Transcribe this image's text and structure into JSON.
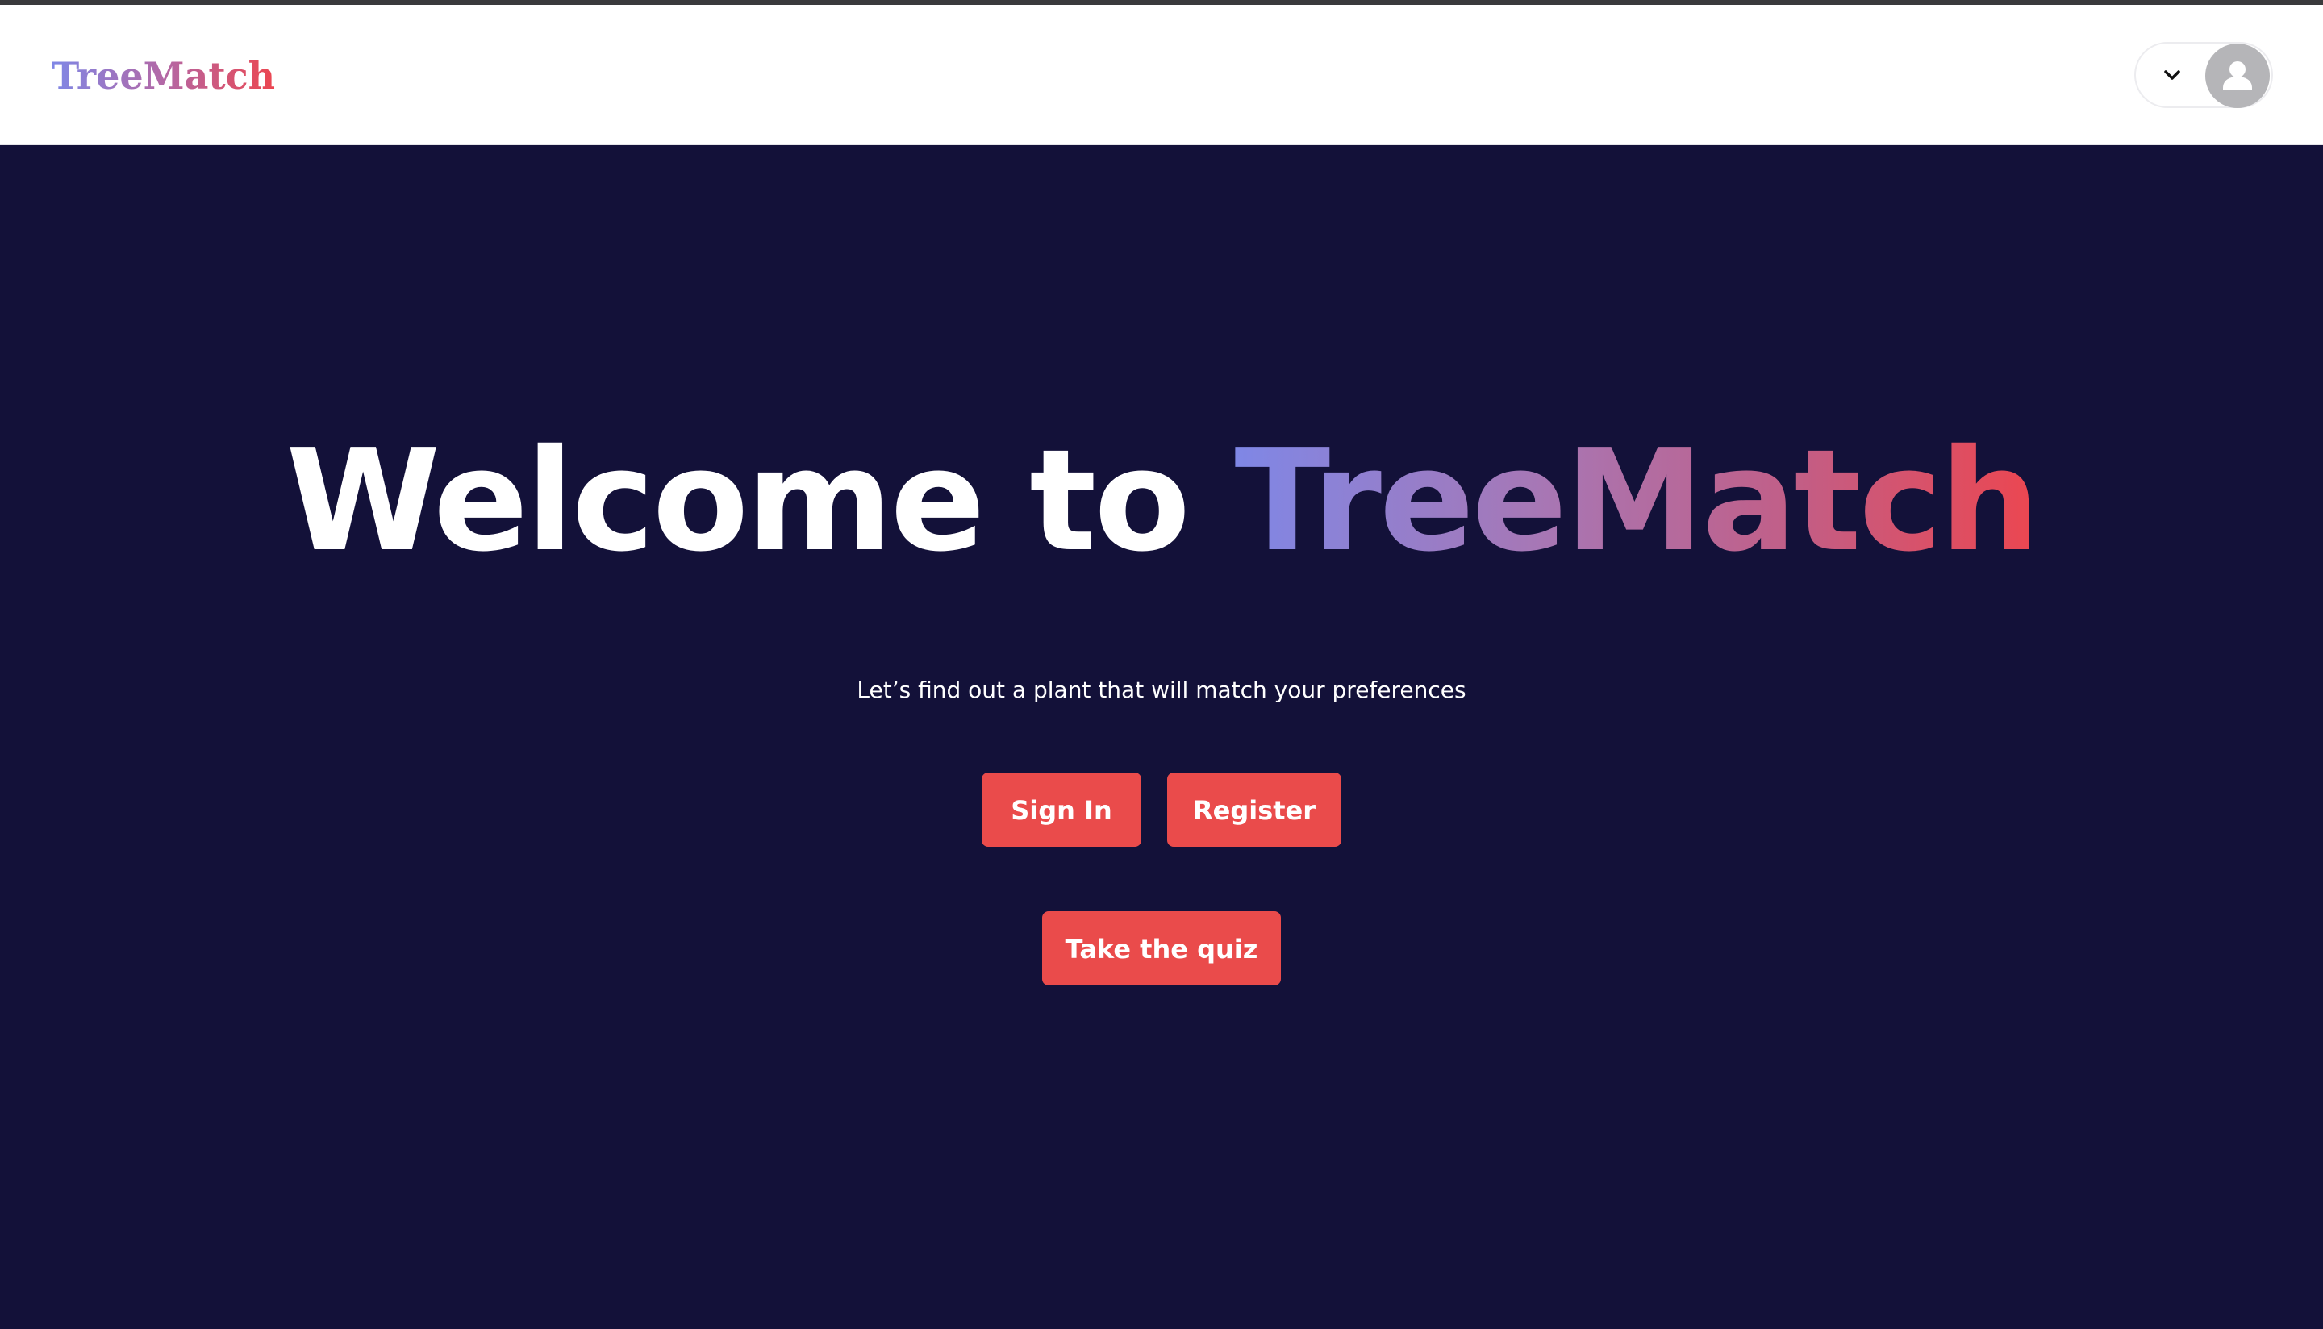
{
  "navbar": {
    "brand": "TreeMatch",
    "user_menu": {
      "chevron_icon": "chevron-down-icon",
      "avatar_icon": "user-avatar-icon"
    }
  },
  "hero": {
    "headline_prefix": "Welcome to ",
    "headline_brand": "TreeMatch",
    "subtitle": "Let’s find out a plant that will match your preferences",
    "buttons": {
      "sign_in": "Sign In",
      "register": "Register",
      "quiz": "Take the quiz"
    }
  },
  "colors": {
    "background": "#131139",
    "button": "#ea4b4b",
    "gradient_start": "#7f87e6",
    "gradient_end": "#ec4650"
  }
}
